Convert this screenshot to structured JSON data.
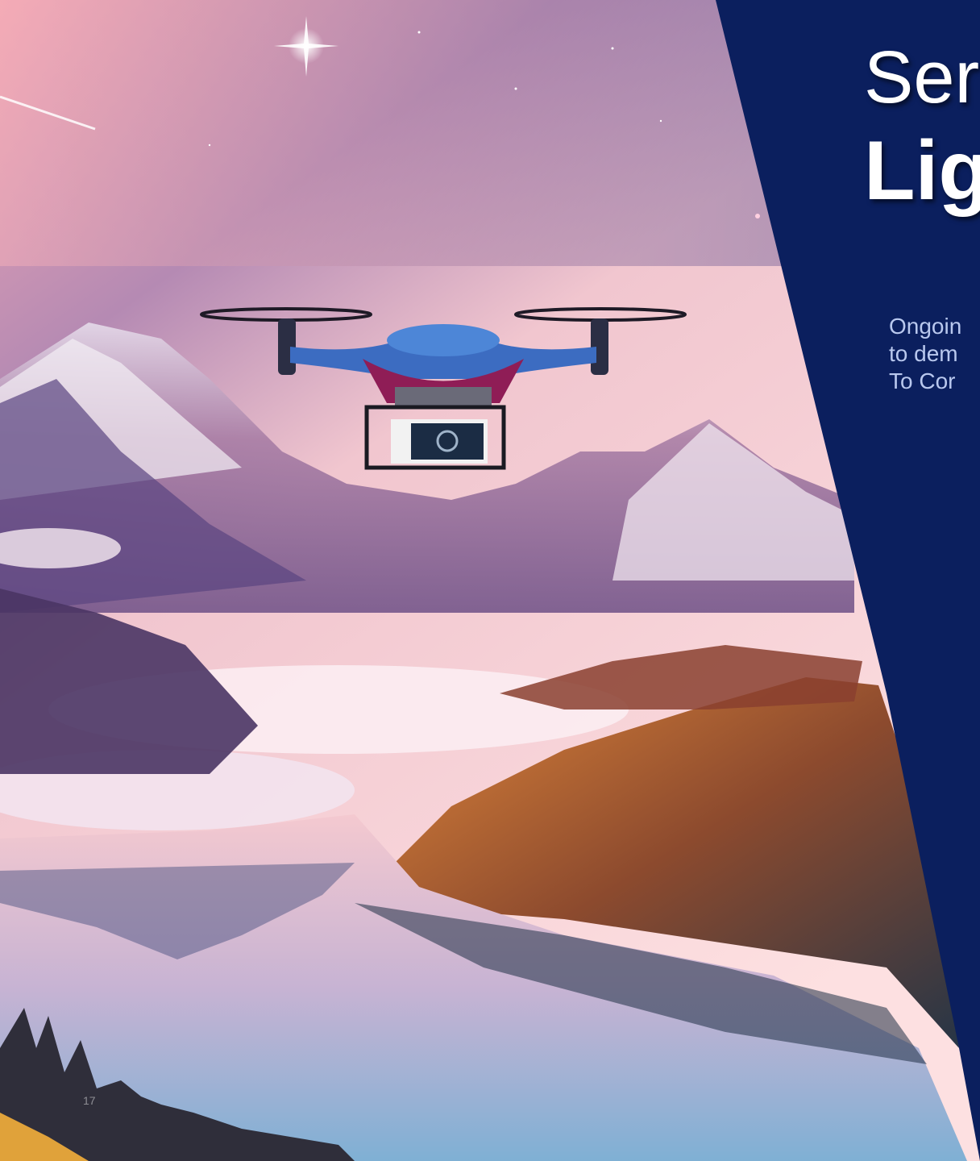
{
  "slide": {
    "title_line1": "Ser",
    "title_line2": "Lig",
    "subtitle_lines": [
      "Ongoin",
      "to dem",
      "To Cor"
    ],
    "slide_number": "17"
  },
  "image": {
    "subject": "drone-over-mountain-lake-illustration",
    "colors": {
      "sky_top": "#6a5e9e",
      "sky_glow": "#f3b7c2",
      "panel": "#0b1f5e",
      "forest_orange": "#d9782e",
      "drone_body": "#3c6cc1"
    }
  }
}
